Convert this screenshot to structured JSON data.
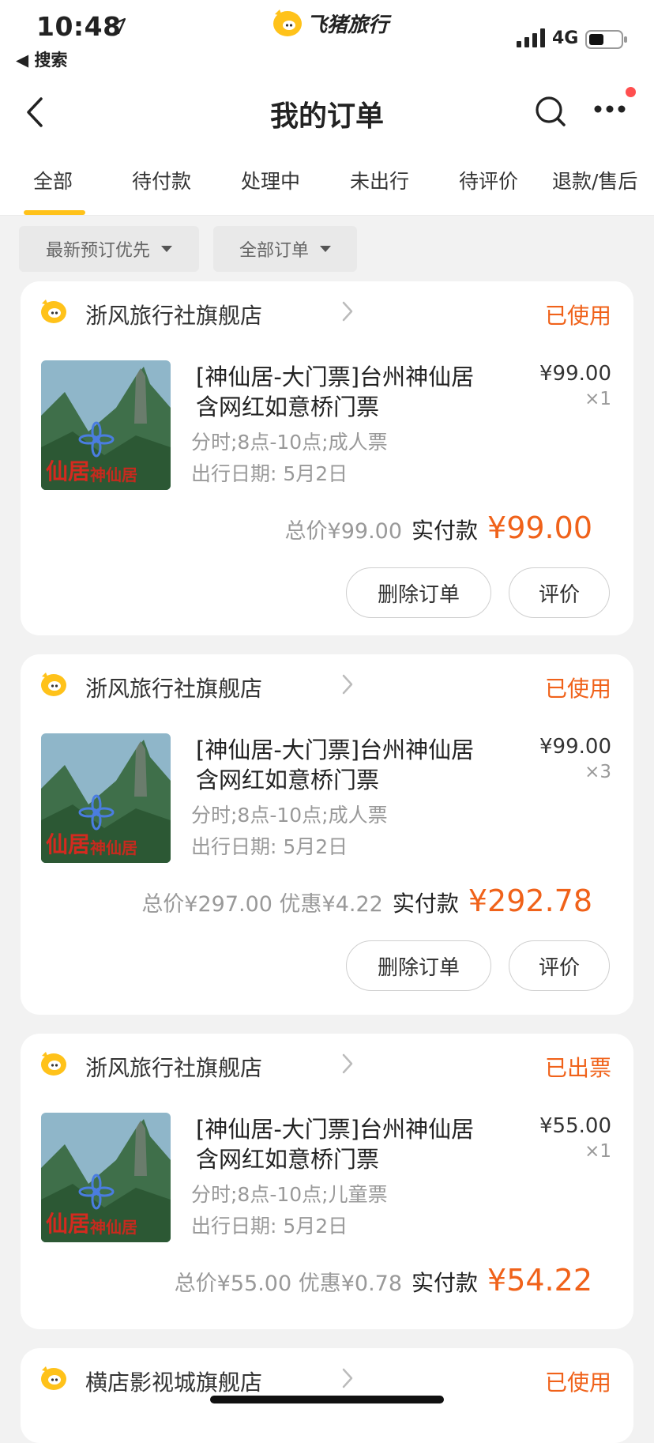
{
  "status_bar": {
    "time": "10:48",
    "back_app": "◀ 搜索",
    "network": "4G"
  },
  "brand": {
    "name": "飞猪旅行"
  },
  "nav": {
    "title": "我的订单"
  },
  "tabs": [
    {
      "label": "全部",
      "selected": true
    },
    {
      "label": "待付款"
    },
    {
      "label": "处理中"
    },
    {
      "label": "未出行"
    },
    {
      "label": "待评价"
    },
    {
      "label": "退款/售后"
    }
  ],
  "filters": [
    {
      "label": "最新预订优先"
    },
    {
      "label": "全部订单"
    }
  ],
  "orders": [
    {
      "shop": "浙风旅行社旗舰店",
      "status": "已使用",
      "title": "[神仙居-大门票]台州神仙居含网红如意桥门票",
      "spec": "分时;8点-10点;成人票",
      "date": "出行日期: 5月2日",
      "price": "¥99.00",
      "qty": "×1",
      "summary_grey": "总价¥99.00",
      "paid_label": "实付款",
      "paid": "¥99.00",
      "buttons": [
        "删除订单",
        "评价"
      ]
    },
    {
      "shop": "浙风旅行社旗舰店",
      "status": "已使用",
      "title": "[神仙居-大门票]台州神仙居含网红如意桥门票",
      "spec": "分时;8点-10点;成人票",
      "date": "出行日期: 5月2日",
      "price": "¥99.00",
      "qty": "×3",
      "summary_grey": "总价¥297.00  优惠¥4.22",
      "paid_label": "实付款",
      "paid": "¥292.78",
      "buttons": [
        "删除订单",
        "评价"
      ]
    },
    {
      "shop": "浙风旅行社旗舰店",
      "status": "已出票",
      "title": "[神仙居-大门票]台州神仙居含网红如意桥门票",
      "spec": "分时;8点-10点;儿童票",
      "date": "出行日期: 5月2日",
      "price": "¥55.00",
      "qty": "×1",
      "summary_grey": "总价¥55.00  优惠¥0.78",
      "paid_label": "实付款",
      "paid": "¥54.22"
    },
    {
      "shop": "横店影视城旗舰店",
      "status": "已使用"
    }
  ],
  "colors": {
    "accent_orange": "#f0621a",
    "tab_underline": "#ffc21a",
    "page_bg": "#f2f2f2",
    "notification_dot": "#ff4f4f"
  },
  "icons": [
    "location-arrow-icon",
    "pig-logo-icon",
    "signal-icon",
    "battery-icon",
    "back-chevron-icon",
    "search-icon",
    "more-icon",
    "chevron-right-icon",
    "caret-down-icon"
  ]
}
